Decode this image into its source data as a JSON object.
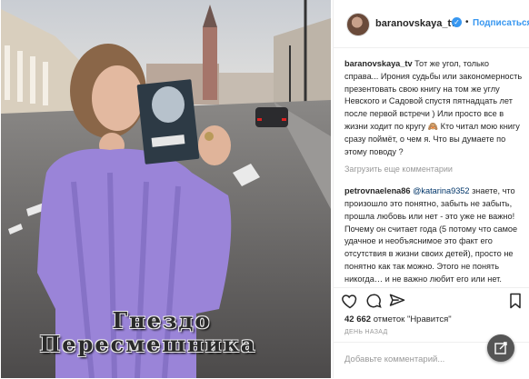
{
  "post": {
    "username": "baranovskaya_tv",
    "follow_label": "Подписаться",
    "separator": "•",
    "caption_user": "baranovskaya_tv",
    "caption_text": "Тот же угол, только справа... Ирония судьбы или закономерность презентовать свою книгу на том же углу Невского и Садовой спустя пятнадцать лет после первой встречи ) Или просто все в жизни ходит по кругу 🙈 Кто читал мою книгу сразу поймёт, о чем я. Что вы думаете по этому поводу ?",
    "load_more": "Загрузить еще комментарии",
    "comment_user": "petrovnaelena86",
    "comment_mention": "@katarina9352",
    "comment_text": "знаете, что произошло это понятно, забыть не забыть, прошла любовь или нет - это уже не важно! Почему он считает года (5 потому что самое удачное и необъяснимое это факт его отсутствия в жизни своих детей), просто не понятно как так можно. Этого не понять никогда… и не важно любит его или нет.",
    "likes_count": "42 662",
    "likes_text": "отметок \"Нравится\"",
    "date": "ДЕНЬ НАЗАД",
    "add_comment_placeholder": "Добавьте комментарий..."
  },
  "watermark": {
    "line1": "Гнездо",
    "line2": "Пересмешника"
  },
  "colors": {
    "link": "#3897f0",
    "text": "#262626",
    "muted": "#999999"
  },
  "icons": {
    "like": "heart-icon",
    "comment": "comment-icon",
    "share": "share-icon",
    "save": "bookmark-icon",
    "verified": "verified-badge-icon",
    "fab": "edit-icon"
  }
}
